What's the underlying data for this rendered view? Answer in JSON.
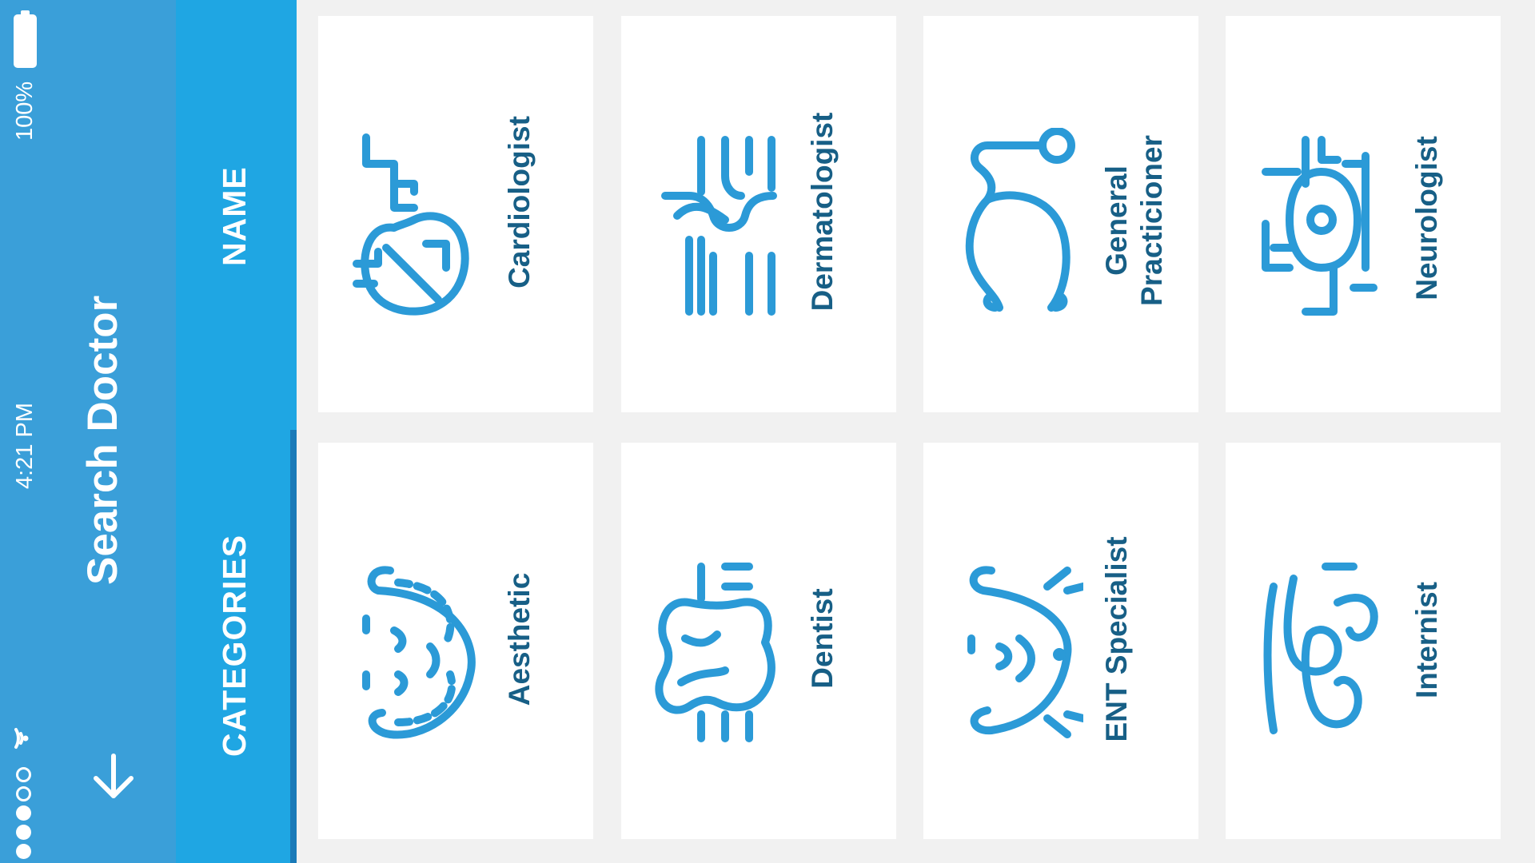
{
  "status_bar": {
    "battery": "100%",
    "time": "4:21 PM"
  },
  "header": {
    "title": "Search Doctor"
  },
  "tabs": [
    {
      "label": "NAME"
    },
    {
      "label": "CATEGORIES"
    }
  ],
  "categories": [
    {
      "label": "Cardiologist",
      "icon": "heart-icon"
    },
    {
      "label": "Dermatologist",
      "icon": "skin-icon"
    },
    {
      "label": "General\nPracticioner",
      "icon": "stethoscope-icon"
    },
    {
      "label": "Neurologist",
      "icon": "neuron-icon"
    },
    {
      "label": "Aesthetic",
      "icon": "face-icon"
    },
    {
      "label": "Dentist",
      "icon": "tooth-icon"
    },
    {
      "label": "ENT Specialist",
      "icon": "ear-nose-throat-icon"
    },
    {
      "label": "Internist",
      "icon": "intestine-icon"
    }
  ],
  "colors": {
    "header": "#3a9fd9",
    "tabbar": "#1fa6e3",
    "icon": "#2b9ad7",
    "label": "#175f86"
  }
}
